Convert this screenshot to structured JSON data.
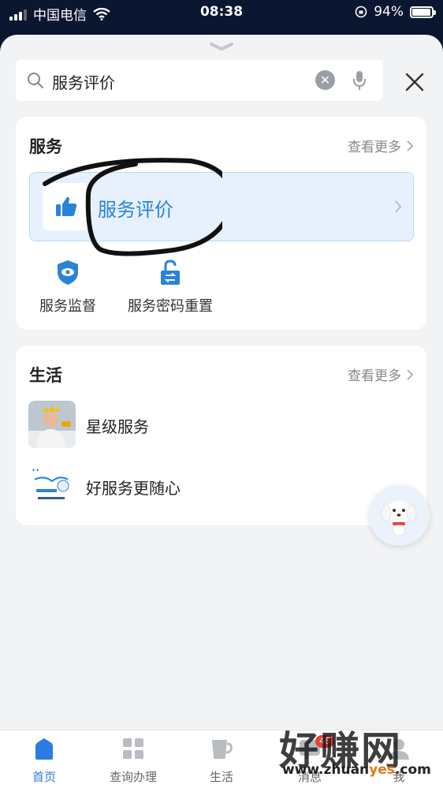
{
  "status_bar": {
    "carrier": "中国电信",
    "time": "08:38",
    "battery": "94%",
    "battery_level": 0.94
  },
  "search": {
    "value": "服务评价"
  },
  "services_card": {
    "title": "服务",
    "more": "查看更多",
    "highlight": {
      "label": "服务评价"
    },
    "items": [
      {
        "label": "服务监督",
        "icon": "shield-eye-icon"
      },
      {
        "label": "服务密码重置",
        "icon": "unlock-icon"
      }
    ]
  },
  "life_card": {
    "title": "生活",
    "more": "查看更多",
    "items": [
      {
        "label": "星级服务",
        "icon": "star-service-thumbnail"
      },
      {
        "label": "好服务更随心",
        "icon": "good-service-thumbnail"
      }
    ]
  },
  "tabbar": {
    "items": [
      {
        "label": "首页",
        "icon": "home-icon",
        "active": true
      },
      {
        "label": "查询办理",
        "icon": "grid-icon"
      },
      {
        "label": "生活",
        "icon": "cup-icon"
      },
      {
        "label": "消息",
        "icon": "message-icon",
        "badge": "48"
      },
      {
        "label": "我",
        "icon": "user-icon"
      }
    ]
  },
  "watermark": {
    "text": "好赚网",
    "url_prefix": "www.zhuan",
    "url_accent": "yes",
    "url_suffix": ".com"
  },
  "colors": {
    "accent": "#2a83d7",
    "highlight_bg": "#e6f1fd",
    "page_bg": "#f2f3f5",
    "badge": "#e9423a"
  }
}
